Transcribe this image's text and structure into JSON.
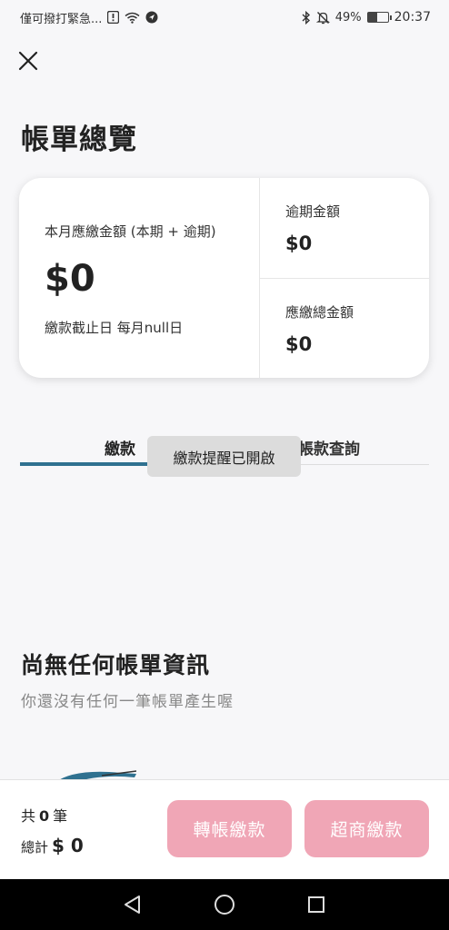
{
  "status_bar": {
    "carrier_text": "僅可撥打緊急...",
    "battery_percent": "49%",
    "battery_level": 0.49,
    "time": "20:37",
    "icons": [
      "alert-icon",
      "wifi-icon",
      "location-icon",
      "bluetooth-icon",
      "mute-icon",
      "battery-icon"
    ]
  },
  "header": {
    "close_icon": "close-icon",
    "title": "帳單總覽"
  },
  "summary": {
    "current_label": "本月應繳金額 (本期 + 逾期)",
    "current_amount": "$0",
    "due_date": "繳款截止日 每月null日",
    "overdue_label": "逾期金額",
    "overdue_amount": "$0",
    "total_label": "應繳總金額",
    "total_amount": "$0"
  },
  "tabs": [
    {
      "label": "繳款",
      "active": true
    },
    {
      "label": "帳款查詢",
      "active": false
    }
  ],
  "toast": "繳款提醒已開啟",
  "empty_state": {
    "title": "尚無任何帳單資訊",
    "subtitle": "你還沒有任何一筆帳單產生喔"
  },
  "footer": {
    "count_prefix": "共",
    "count_value": "0",
    "count_suffix": "筆",
    "total_prefix": "總計",
    "total_value": "$ 0",
    "transfer_button": "轉帳繳款",
    "store_button": "超商繳款"
  },
  "colors": {
    "accent": "#2f7190",
    "button_disabled": "#f0a6b6",
    "background": "#f7f7f9"
  },
  "nav": {
    "icons": [
      "back-icon",
      "home-icon",
      "recents-icon"
    ]
  }
}
